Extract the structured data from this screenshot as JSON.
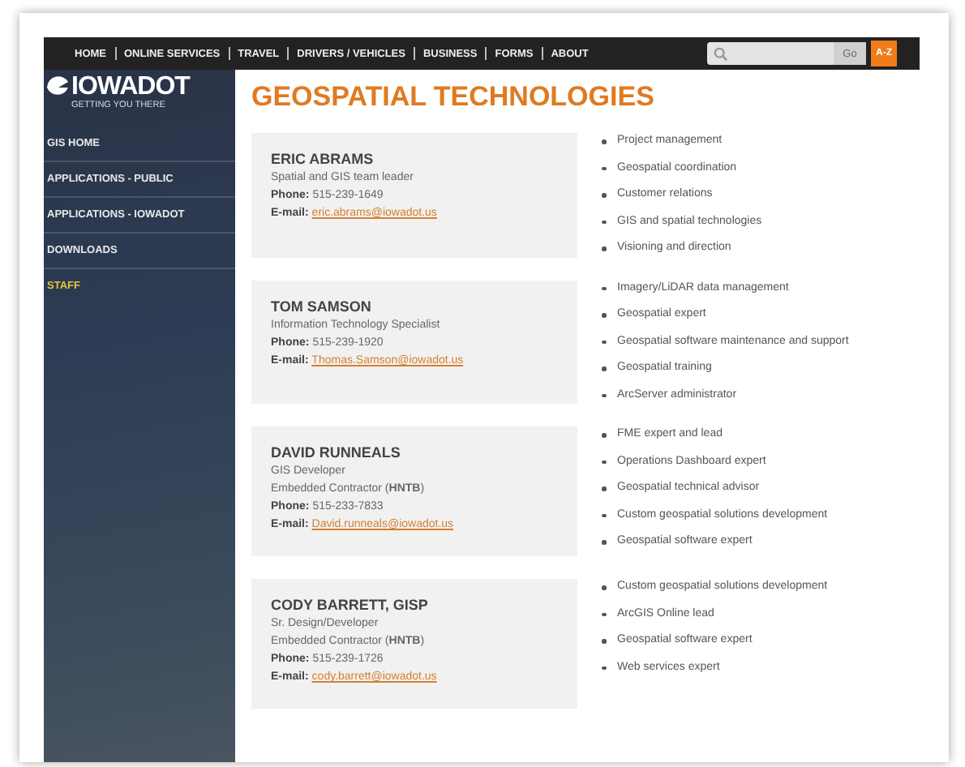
{
  "nav": {
    "items": [
      "HOME",
      "ONLINE SERVICES",
      "TRAVEL",
      "DRIVERS / VEHICLES",
      "BUSINESS",
      "FORMS",
      "ABOUT"
    ],
    "search_button": "Go",
    "az_button": "A-Z"
  },
  "logo": {
    "name": "IOWADOT",
    "tagline": "GETTING YOU THERE"
  },
  "sidebar": {
    "items": [
      {
        "label": "GIS HOME",
        "selected": false
      },
      {
        "label": "APPLICATIONS - PUBLIC",
        "selected": false
      },
      {
        "label": "APPLICATIONS - IOWADOT",
        "selected": false
      },
      {
        "label": "DOWNLOADS",
        "selected": false
      },
      {
        "label": "STAFF",
        "selected": true
      }
    ]
  },
  "page_title": "GEOSPATIAL TECHNOLOGIES",
  "staff": [
    {
      "name": "ERIC ABRAMS",
      "roles": [
        "Spatial and GIS team leader"
      ],
      "phone_label": "Phone:",
      "phone": "515-239-1649",
      "email_label": "E-mail:",
      "email": "eric.abrams@iowadot.us",
      "duties": [
        "Project management",
        "Geospatial coordination",
        "Customer relations",
        "GIS and spatial technologies",
        "Visioning and direction"
      ]
    },
    {
      "name": "TOM SAMSON",
      "roles": [
        "Information Technology Specialist"
      ],
      "phone_label": "Phone:",
      "phone": "515-239-1920",
      "email_label": "E-mail:",
      "email": "Thomas.Samson@iowadot.us",
      "duties": [
        "Imagery/LiDAR data management",
        "Geospatial expert",
        "Geospatial software maintenance and support",
        "Geospatial training",
        "ArcServer administrator"
      ]
    },
    {
      "name": "DAVID RUNNEALS",
      "roles": [
        "GIS Developer",
        "Embedded Contractor (**HNTB**)"
      ],
      "phone_label": "Phone:",
      "phone": "515-233-7833",
      "email_label": "E-mail:",
      "email": "David.runneals@iowadot.us",
      "duties": [
        "FME expert and lead",
        "Operations Dashboard expert",
        "Geospatial technical advisor",
        "Custom geospatial solutions development",
        "Geospatial software expert"
      ]
    },
    {
      "name": "CODY BARRETT, GISP",
      "roles": [
        "Sr. Design/Developer",
        "Embedded Contractor (**HNTB**)"
      ],
      "phone_label": "Phone:",
      "phone": "515-239-1726",
      "email_label": "E-mail:",
      "email": "cody.barrett@iowadot.us",
      "duties": [
        "Custom geospatial solutions development",
        "ArcGIS Online lead",
        "Geospatial software expert",
        "Web services expert"
      ]
    }
  ]
}
